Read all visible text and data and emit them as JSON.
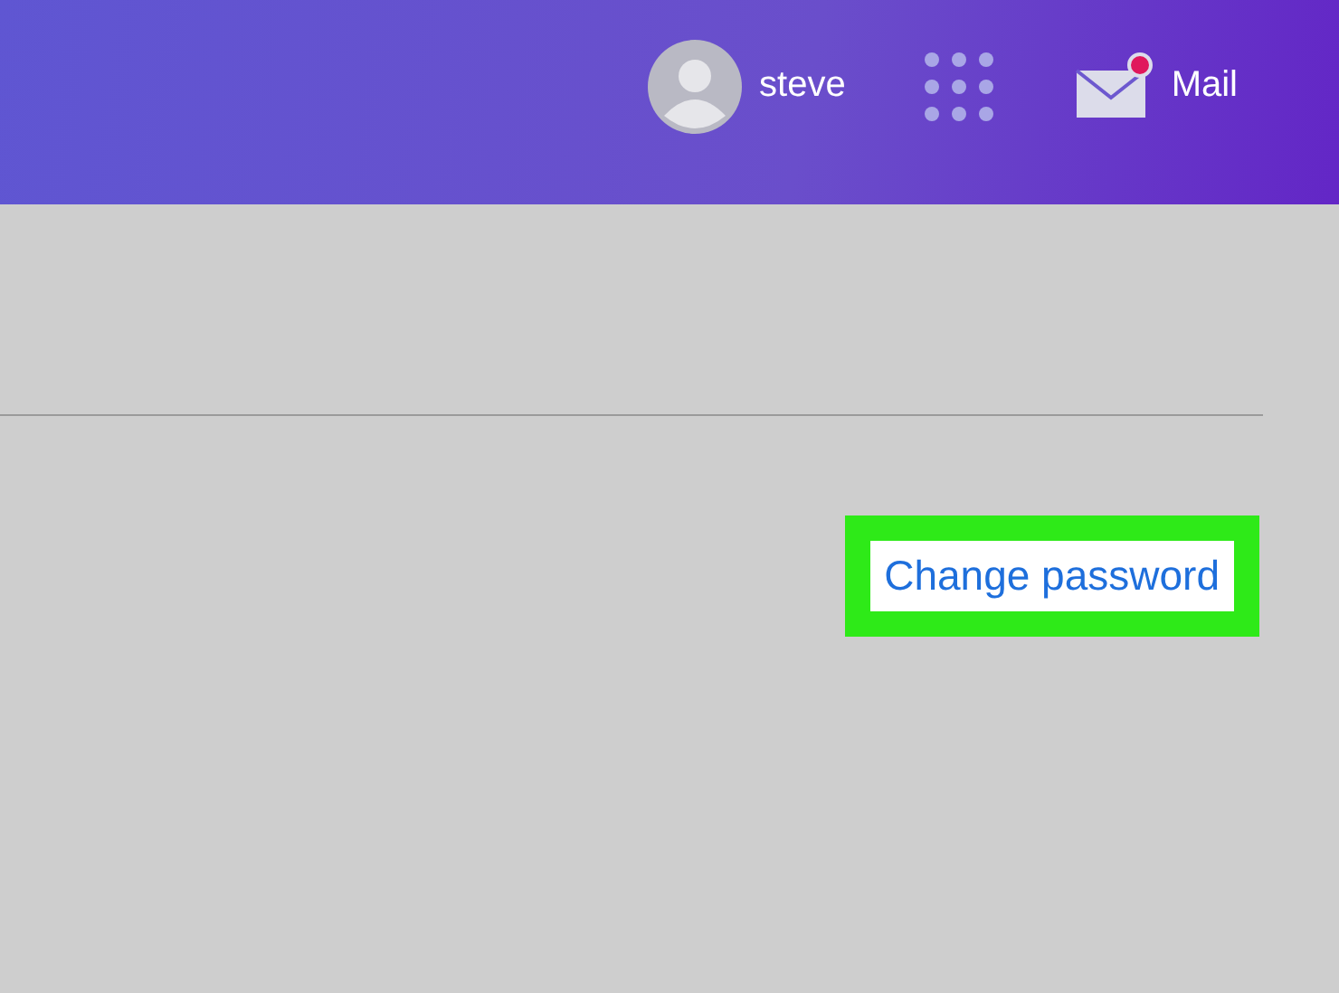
{
  "header": {
    "user": {
      "name": "steve"
    },
    "mail": {
      "label": "Mail",
      "unread": true
    }
  },
  "link": {
    "label": "Change password",
    "highlighted": true
  }
}
